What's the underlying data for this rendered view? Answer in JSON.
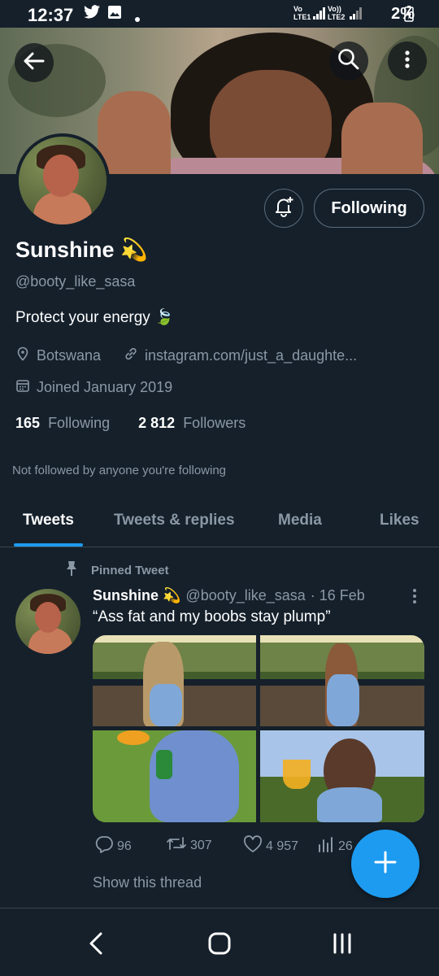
{
  "status_bar": {
    "time": "12:37",
    "notification_icons": [
      "twitter-bird-icon",
      "gallery-icon",
      "dot-icon"
    ],
    "sim1": "Vo\nLTE1",
    "sim2": "Vo))\nLTE2",
    "battery": "2%"
  },
  "header": {
    "back_icon": "back-arrow-icon",
    "search_icon": "search-icon",
    "more_icon": "more-vertical-icon"
  },
  "profile": {
    "name": "Sunshine 💫",
    "handle": "@booty_like_sasa",
    "bio": "Protect your energy 🍃",
    "location": "Botswana",
    "website": "instagram.com/just_a_daughte...",
    "joined": "Joined January 2019",
    "following_count": "165",
    "following_label": "Following",
    "followers_count": "2 812",
    "followers_label": "Followers",
    "not_followed_note": "Not followed by anyone you're following",
    "follow_button_label": "Following"
  },
  "tabs": [
    {
      "label": "Tweets",
      "active": true
    },
    {
      "label": "Tweets & replies",
      "active": false
    },
    {
      "label": "Media",
      "active": false
    },
    {
      "label": "Likes",
      "active": false
    }
  ],
  "pinned_tweet": {
    "pinned_label": "Pinned Tweet",
    "author_name": "Sunshine 💫",
    "author_handle": "@booty_like_sasa",
    "date": "· 16 Feb",
    "text": "“Ass fat and my boobs stay plump”",
    "media_count": 4,
    "replies": "96",
    "retweets": "307",
    "likes": "4 957",
    "views": "26",
    "show_thread": "Show this thread"
  },
  "colors": {
    "background": "#15202b",
    "accent": "#1d9bf0",
    "secondary_text": "#8b98a5",
    "border": "#38444d"
  }
}
